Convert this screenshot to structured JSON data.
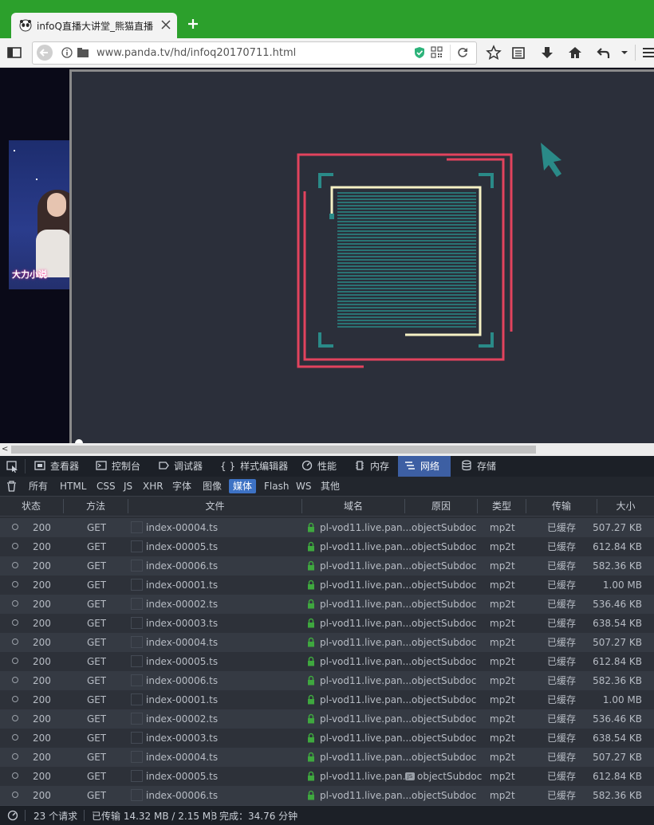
{
  "browser": {
    "tab_title": "infoQ直播大讲堂_熊猫直播",
    "url": "www.panda.tv/hd/infoq20170711.html"
  },
  "thumbnail": {
    "logo_text": "大力小说"
  },
  "devtools": {
    "tabs": [
      {
        "label": "查看器"
      },
      {
        "label": "控制台"
      },
      {
        "label": "调试器"
      },
      {
        "label": "样式编辑器"
      },
      {
        "label": "性能"
      },
      {
        "label": "内存"
      },
      {
        "label": "网络"
      },
      {
        "label": "存储"
      }
    ],
    "active_tab": "网络",
    "filters": [
      "所有",
      "HTML",
      "CSS",
      "JS",
      "XHR",
      "字体",
      "图像",
      "媒体",
      "Flash",
      "WS",
      "其他"
    ],
    "active_filter": "媒体",
    "columns": [
      "状态",
      "方法",
      "文件",
      "域名",
      "原因",
      "类型",
      "传输",
      "大小"
    ],
    "rows": [
      {
        "status": "200",
        "method": "GET",
        "file": "index-00004.ts",
        "domain": "pl-vod11.live.pan...",
        "cause": "objectSubdoc",
        "type": "mp2t",
        "transferred": "已缓存",
        "size": "507.27 KB"
      },
      {
        "status": "200",
        "method": "GET",
        "file": "index-00005.ts",
        "domain": "pl-vod11.live.pan...",
        "cause": "objectSubdoc",
        "type": "mp2t",
        "transferred": "已缓存",
        "size": "612.84 KB"
      },
      {
        "status": "200",
        "method": "GET",
        "file": "index-00006.ts",
        "domain": "pl-vod11.live.pan...",
        "cause": "objectSubdoc",
        "type": "mp2t",
        "transferred": "已缓存",
        "size": "582.36 KB"
      },
      {
        "status": "200",
        "method": "GET",
        "file": "index-00001.ts",
        "domain": "pl-vod11.live.pan...",
        "cause": "objectSubdoc",
        "type": "mp2t",
        "transferred": "已缓存",
        "size": "1.00 MB"
      },
      {
        "status": "200",
        "method": "GET",
        "file": "index-00002.ts",
        "domain": "pl-vod11.live.pan...",
        "cause": "objectSubdoc",
        "type": "mp2t",
        "transferred": "已缓存",
        "size": "536.46 KB"
      },
      {
        "status": "200",
        "method": "GET",
        "file": "index-00003.ts",
        "domain": "pl-vod11.live.pan...",
        "cause": "objectSubdoc",
        "type": "mp2t",
        "transferred": "已缓存",
        "size": "638.54 KB"
      },
      {
        "status": "200",
        "method": "GET",
        "file": "index-00004.ts",
        "domain": "pl-vod11.live.pan...",
        "cause": "objectSubdoc",
        "type": "mp2t",
        "transferred": "已缓存",
        "size": "507.27 KB"
      },
      {
        "status": "200",
        "method": "GET",
        "file": "index-00005.ts",
        "domain": "pl-vod11.live.pan...",
        "cause": "objectSubdoc",
        "type": "mp2t",
        "transferred": "已缓存",
        "size": "612.84 KB"
      },
      {
        "status": "200",
        "method": "GET",
        "file": "index-00006.ts",
        "domain": "pl-vod11.live.pan...",
        "cause": "objectSubdoc",
        "type": "mp2t",
        "transferred": "已缓存",
        "size": "582.36 KB"
      },
      {
        "status": "200",
        "method": "GET",
        "file": "index-00001.ts",
        "domain": "pl-vod11.live.pan...",
        "cause": "objectSubdoc",
        "type": "mp2t",
        "transferred": "已缓存",
        "size": "1.00 MB"
      },
      {
        "status": "200",
        "method": "GET",
        "file": "index-00002.ts",
        "domain": "pl-vod11.live.pan...",
        "cause": "objectSubdoc",
        "type": "mp2t",
        "transferred": "已缓存",
        "size": "536.46 KB"
      },
      {
        "status": "200",
        "method": "GET",
        "file": "index-00003.ts",
        "domain": "pl-vod11.live.pan...",
        "cause": "objectSubdoc",
        "type": "mp2t",
        "transferred": "已缓存",
        "size": "638.54 KB"
      },
      {
        "status": "200",
        "method": "GET",
        "file": "index-00004.ts",
        "domain": "pl-vod11.live.pan...",
        "cause": "objectSubdoc",
        "type": "mp2t",
        "transferred": "已缓存",
        "size": "507.27 KB"
      },
      {
        "status": "200",
        "method": "GET",
        "file": "index-00005.ts",
        "domain": "pl-vod11.live.pan...",
        "cause": "objectSubdoc",
        "type": "mp2t",
        "transferred": "已缓存",
        "size": "612.84 KB",
        "cause_badge": "JS"
      },
      {
        "status": "200",
        "method": "GET",
        "file": "index-00006.ts",
        "domain": "pl-vod11.live.pan...",
        "cause": "objectSubdoc",
        "type": "mp2t",
        "transferred": "已缓存",
        "size": "582.36 KB"
      }
    ],
    "status_bar": {
      "requests": "23 个请求",
      "transferred": "已传输 14.32 MB / 2.15 MB",
      "finish": "完成：34.76 分钟"
    }
  },
  "colors": {
    "tabstrip": "#2ca02c",
    "accent_red": "#e2435d",
    "accent_teal": "#2a8a88",
    "accent_cream": "#f6f1c4",
    "devtools_active": "#3d5fa3"
  },
  "icons": [
    "panda-icon",
    "close-icon",
    "plus-icon",
    "sidebar-icon",
    "back-icon",
    "info-icon",
    "folder-icon",
    "shield-icon",
    "qr-icon",
    "reload-icon",
    "star-icon",
    "reading-list-icon",
    "download-icon",
    "home-icon",
    "undo-icon",
    "menu-icon",
    "cursor-icon",
    "lock-icon",
    "status-dot-icon",
    "trash-icon",
    "pick-element-icon"
  ]
}
